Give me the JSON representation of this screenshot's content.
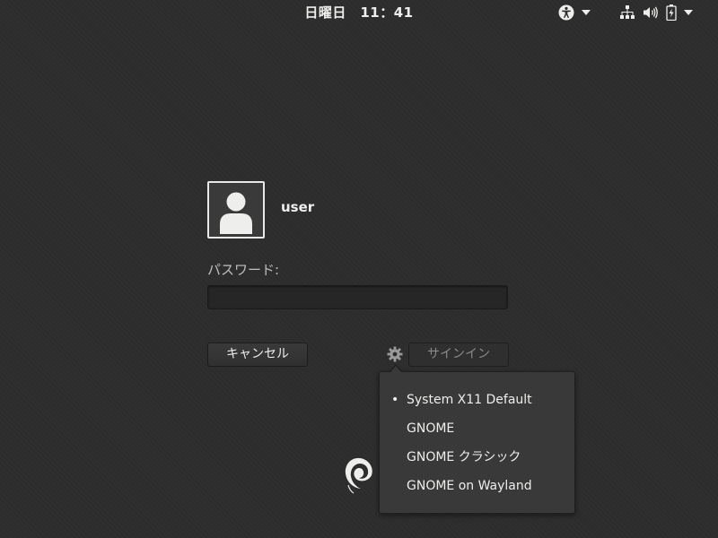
{
  "topbar": {
    "clock": "日曜日　11：41",
    "icons": [
      "accessibility-icon",
      "chevron-down-icon",
      "network-wired-icon",
      "volume-icon",
      "battery-charging-icon",
      "chevron-down-icon"
    ]
  },
  "login": {
    "username": "user",
    "password_label": "パスワード:",
    "password_value": "",
    "cancel_label": "キャンセル",
    "signin_label": "サインイン"
  },
  "session_menu": {
    "selected_index": 0,
    "selected_marker": "•",
    "items": [
      {
        "label": "System X11 Default"
      },
      {
        "label": "GNOME"
      },
      {
        "label": "GNOME クラシック"
      },
      {
        "label": "GNOME on Wayland"
      }
    ]
  },
  "colors": {
    "background": "#2d2d2d",
    "text": "#eeeeec",
    "menu_bg": "#393939",
    "disabled_text": "#8a8a8a"
  }
}
